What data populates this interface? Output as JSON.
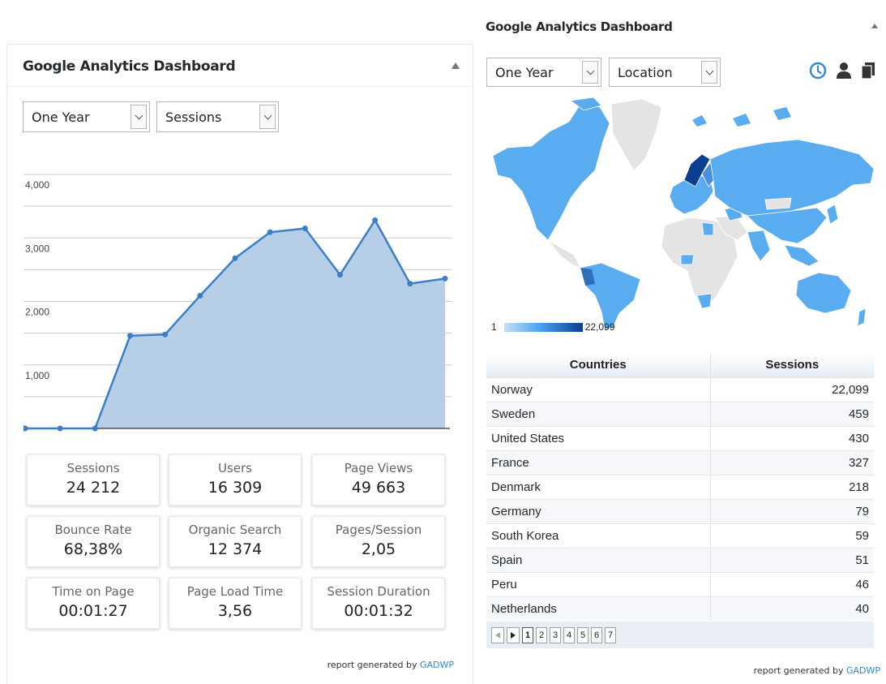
{
  "left_panel": {
    "title": "Google Analytics Dashboard",
    "period_select": "One Year",
    "metric_select": "Sessions",
    "chart_data": {
      "type": "area",
      "x": [
        "1",
        "2",
        "3",
        "4",
        "5",
        "6",
        "7",
        "8",
        "9",
        "10",
        "11",
        "12",
        "13"
      ],
      "values": [
        0,
        0,
        0,
        1460,
        1480,
        2090,
        2680,
        3090,
        3150,
        2420,
        3280,
        2280,
        2360
      ],
      "ylim": [
        0,
        4000
      ],
      "yticks": [
        "4,000",
        "3,000",
        "2,000",
        "1,000"
      ],
      "grid": true,
      "fill_color": "#b6cfe7",
      "line_color": "#3a7fc8"
    },
    "stats": [
      {
        "label": "Sessions",
        "value": "24 212"
      },
      {
        "label": "Users",
        "value": "16 309"
      },
      {
        "label": "Page Views",
        "value": "49 663"
      },
      {
        "label": "Bounce Rate",
        "value": "68,38%"
      },
      {
        "label": "Organic Search",
        "value": "12 374"
      },
      {
        "label": "Pages/Session",
        "value": "2,05"
      },
      {
        "label": "Time on Page",
        "value": "00:01:27"
      },
      {
        "label": "Page Load Time",
        "value": "3,56"
      },
      {
        "label": "Session Duration",
        "value": "00:01:32"
      }
    ],
    "footer_text": "report generated by",
    "footer_link": "GADWP"
  },
  "right_panel": {
    "title": "Google Analytics Dashboard",
    "period_select": "One Year",
    "metric_select": "Location",
    "icons": [
      "clock-icon",
      "user-icon",
      "pages-icon"
    ],
    "accent_color": "#2e8ad6",
    "map_colors": {
      "low": "#5aacf0",
      "high": "#0b3d91",
      "none": "#e4e4e4"
    },
    "legend_min": "1",
    "legend_max": "22,099",
    "table": {
      "headers": [
        "Countries",
        "Sessions"
      ],
      "rows": [
        {
          "country": "Norway",
          "sessions": "22,099"
        },
        {
          "country": "Sweden",
          "sessions": "459"
        },
        {
          "country": "United States",
          "sessions": "430"
        },
        {
          "country": "France",
          "sessions": "327"
        },
        {
          "country": "Denmark",
          "sessions": "218"
        },
        {
          "country": "Germany",
          "sessions": "79"
        },
        {
          "country": "South Korea",
          "sessions": "59"
        },
        {
          "country": "Spain",
          "sessions": "51"
        },
        {
          "country": "Peru",
          "sessions": "46"
        },
        {
          "country": "Netherlands",
          "sessions": "40"
        }
      ]
    },
    "pager": {
      "pages": [
        "1",
        "2",
        "3",
        "4",
        "5",
        "6",
        "7"
      ],
      "current": "1"
    },
    "footer_text": "report generated by",
    "footer_link": "GADWP"
  }
}
